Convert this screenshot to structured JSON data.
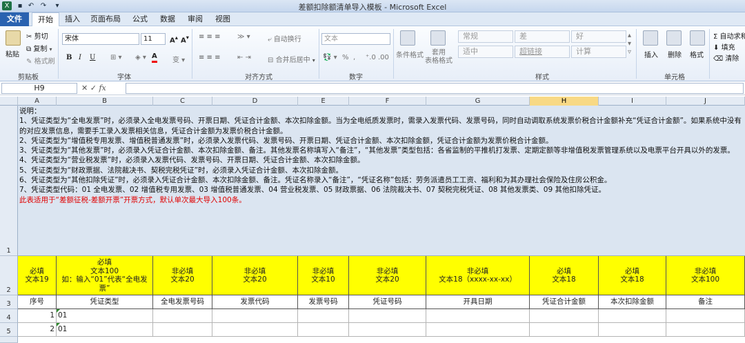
{
  "window": {
    "title": "差额扣除额清单导入模板 - Microsoft Excel"
  },
  "ribbon_tabs": [
    "文件",
    "开始",
    "插入",
    "页面布局",
    "公式",
    "数据",
    "审阅",
    "视图"
  ],
  "clipboard": {
    "paste": "粘贴",
    "cut": "剪切",
    "copy": "复制",
    "format_painter": "格式刷",
    "label": "剪贴板"
  },
  "font": {
    "name": "宋体",
    "size": "11",
    "label": "字体",
    "bold": "B",
    "italic": "I",
    "underline": "U"
  },
  "alignment": {
    "wrap": "自动换行",
    "merge": "合并后居中",
    "label": "对齐方式"
  },
  "number": {
    "format": "文本",
    "label": "数字",
    "percent": "%",
    "comma": ","
  },
  "styles": {
    "conditional": "条件格式",
    "table": "套用\n表格格式",
    "normal": "常规",
    "bad": "差",
    "good": "好",
    "neutral": "适中",
    "hyperlink": "超链接",
    "calc": "计算",
    "label": "样式"
  },
  "cells": {
    "insert": "插入",
    "delete": "删除",
    "format": "格式",
    "label": "单元格"
  },
  "editing": {
    "autosum": "Σ 自动求和",
    "fill": "填充",
    "clear": "清除"
  },
  "formula_bar": {
    "name_box": "H9",
    "fx": "fx",
    "value": ""
  },
  "columns": [
    "A",
    "B",
    "C",
    "D",
    "E",
    "F",
    "G",
    "H",
    "I",
    "J"
  ],
  "selected_column": "H",
  "instructions": [
    "说明：",
    "1、凭证类型为“全电发票”时，必须录入全电发票号码、开票日期、凭证合计金额、本次扣除金额。当为全电纸质发票时，需录入发票代码、发票号码，同时自动调取系统发票价税合计金额补充“凭证合计金额”。如果系统中没有的对应发票信息，需要手工录入发票相关信息，凭证合计金额为发票价税合计金额。",
    "2、凭证类型为“增值税专用发票、增值税普通发票”时，必须录入发票代码、发票号码、开票日期、凭证合计金额、本次扣除金额，凭证合计金额为发票价税合计金额。",
    "3、凭证类型为“其他发票”时，必须录入凭证合计金额、本次扣除金额、备注。其他发票名称填写入“备注”，“其他发票”类型包括：各省监制的平推机打发票、定期定额等非增值税发票管理系统以及电票平台开具以外的发票。",
    "4、凭证类型为“营业税发票”时，必须录入发票代码、发票号码、开票日期、凭证合计金额、本次扣除金额。",
    "5、凭证类型为“财政票据、法院裁决书、契税完税凭证”时，必须录入凭证合计金额、本次扣除金额。",
    "6、凭证类型为“其他扣除凭证”时，必须录入凭证合计金额、本次扣除金额、备注。凭证名称录入“备注”，“凭证名称”包括：劳务派遣员工工资、福利和为其办理社会保险及住房公积金。",
    "7、凭证类型代码：01 全电发票、02 增值税专用发票、03 增值税普通发票、04 营业税发票、05 财政票据、06 法院裁决书、07 契税完税凭证、08 其他发票类、09 其他扣除凭证。"
  ],
  "instructions_note": "此表适用于“差额征税-差额开票”开票方式，默认单次最大导入100条。",
  "row2": [
    "必填\n文本19",
    "必填\n文本100\n如：输入“01”代表“全电发票”",
    "非必填\n文本20",
    "非必填\n文本20",
    "非必填\n文本10",
    "非必填\n文本20",
    "非必填\n文本18（xxxx-xx-xx）",
    "必填\n文本18",
    "必填\n文本18",
    "非必填\n文本100"
  ],
  "row3": [
    "序号",
    "凭证类型",
    "全电发票号码",
    "发票代码",
    "发票号码",
    "凭证号码",
    "开具日期",
    "凭证合计金额",
    "本次扣除金额",
    "备注"
  ],
  "data_rows": [
    {
      "seq": "1",
      "type": "01"
    },
    {
      "seq": "2",
      "type": "01"
    }
  ],
  "row_numbers": [
    "1",
    "2",
    "3",
    "4",
    "5"
  ]
}
